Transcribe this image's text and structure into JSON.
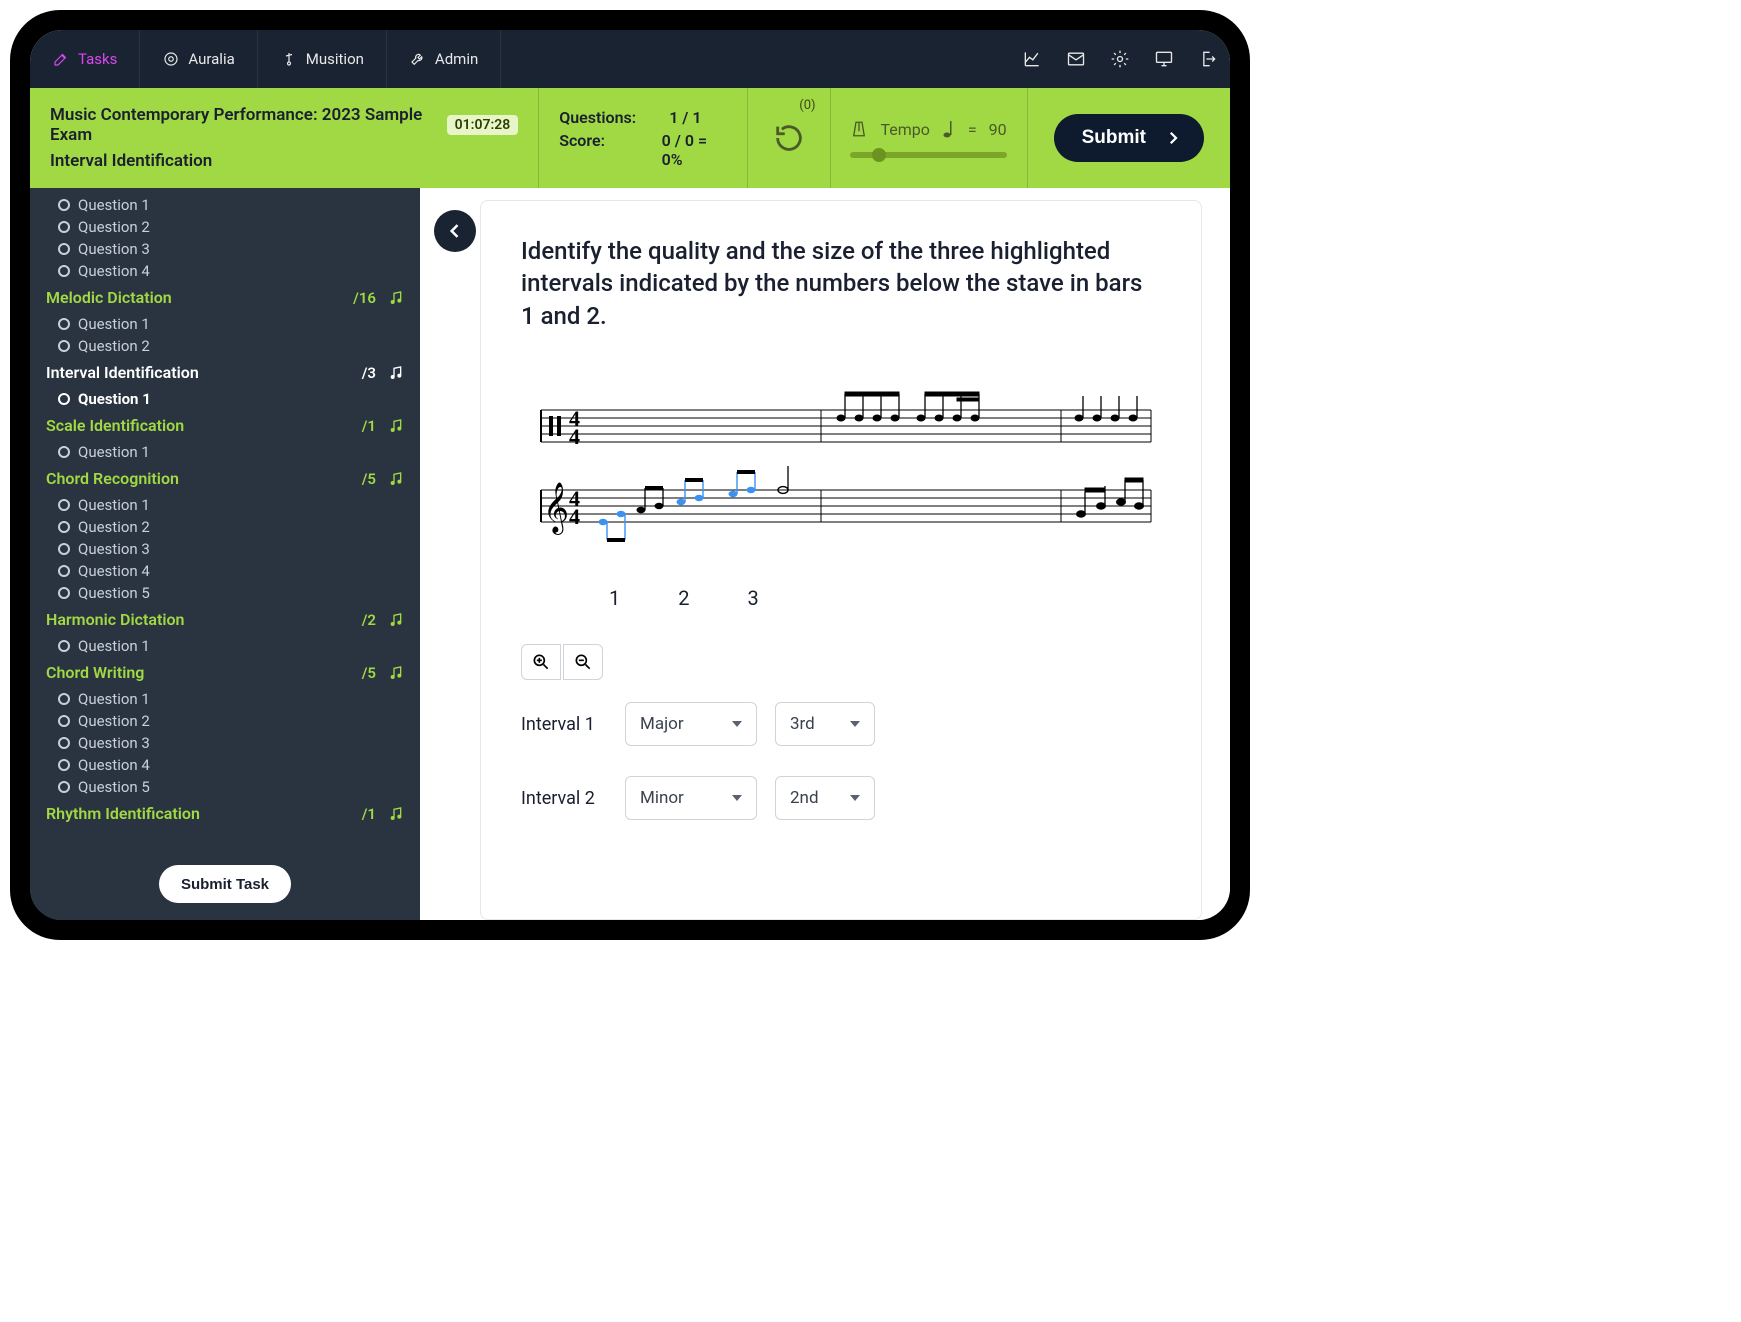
{
  "nav": {
    "tasks": "Tasks",
    "auralia": "Auralia",
    "musition": "Musition",
    "admin": "Admin"
  },
  "greenbar": {
    "exam_title": "Music Contemporary Performance: 2023 Sample Exam",
    "topic_title": "Interval Identification",
    "timer": "01:07:28",
    "questions_label": "Questions:",
    "questions_value": "1 / 1",
    "score_label": "Score:",
    "score_value": "0 / 0 = 0%",
    "replay_count": "(0)",
    "tempo_label": "Tempo",
    "tempo_eq": "=",
    "tempo_value": "90",
    "submit_label": "Submit"
  },
  "sidebar": {
    "sections": [
      {
        "title": "",
        "color": "green",
        "points": "",
        "questions": [
          "Question 1",
          "Question 2",
          "Question 3",
          "Question 4"
        ]
      },
      {
        "title": "Melodic Dictation",
        "color": "green",
        "points": "/16",
        "questions": [
          "Question 1",
          "Question 2"
        ]
      },
      {
        "title": "Interval Identification",
        "color": "white",
        "points": "/3",
        "questions": [
          "Question 1"
        ],
        "active_q": 0
      },
      {
        "title": "Scale Identification",
        "color": "green",
        "points": "/1",
        "questions": [
          "Question 1"
        ]
      },
      {
        "title": "Chord Recognition",
        "color": "green",
        "points": "/5",
        "questions": [
          "Question 1",
          "Question 2",
          "Question 3",
          "Question 4",
          "Question 5"
        ]
      },
      {
        "title": "Harmonic Dictation",
        "color": "green",
        "points": "/2",
        "questions": [
          "Question 1"
        ]
      },
      {
        "title": "Chord Writing",
        "color": "green",
        "points": "/5",
        "questions": [
          "Question 1",
          "Question 2",
          "Question 3",
          "Question 4",
          "Question 5"
        ]
      },
      {
        "title": "Rhythm Identification",
        "color": "green",
        "points": "/1",
        "questions": []
      }
    ],
    "submit_task": "Submit Task"
  },
  "main": {
    "prompt": "Identify the quality and the size of the three highlighted intervals indicated by the numbers below the stave in bars 1 and 2.",
    "interval_numbers": [
      "1",
      "2",
      "3"
    ],
    "answers": [
      {
        "label": "Interval 1",
        "quality": "Major",
        "size": "3rd"
      },
      {
        "label": "Interval 2",
        "quality": "Minor",
        "size": "2nd"
      }
    ]
  }
}
